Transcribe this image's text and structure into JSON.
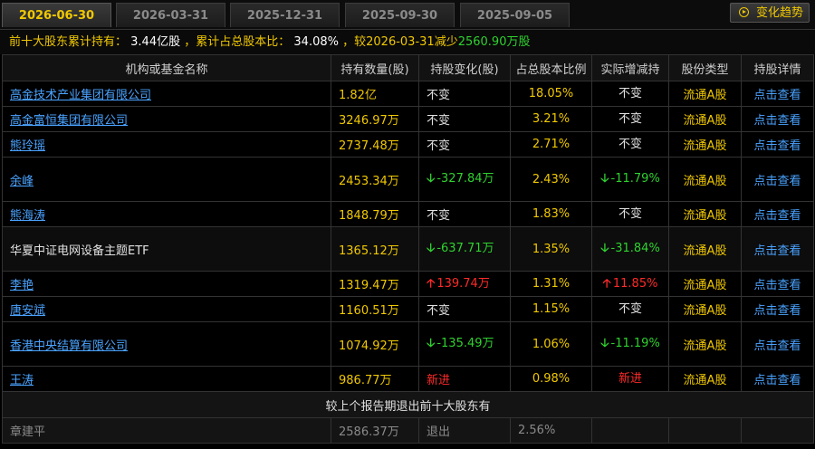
{
  "tabs": [
    {
      "label": "2026-06-30",
      "active": true
    },
    {
      "label": "2026-03-31",
      "active": false
    },
    {
      "label": "2025-12-31",
      "active": false
    },
    {
      "label": "2025-09-30",
      "active": false
    },
    {
      "label": "2025-09-05",
      "active": false
    }
  ],
  "trend_button": {
    "label": "变化趋势"
  },
  "summary": {
    "prefix": "前十大股东累计持有：",
    "total": "3.44亿股",
    "ratio_label": "，累计占总股本比：",
    "ratio": "34.08%",
    "compare_label": "，较",
    "compare_date": "2026-03-31",
    "change_label": "减少",
    "change_value": "2560.90万股"
  },
  "columns": [
    "机构或基金名称",
    "持有数量(股)",
    "持股变化(股)",
    "占总股本比例",
    "实际增减持",
    "股份类型",
    "持股详情"
  ],
  "rows": [
    {
      "name": "高金技术产业集团有限公司",
      "link": true,
      "hold": "1.82亿",
      "change": "不变",
      "change_dir": "none",
      "ratio": "18.05%",
      "actual": "不变",
      "actual_dir": "none",
      "type": "流通A股",
      "detail": "点击查看",
      "tall": false
    },
    {
      "name": "高金富恒集团有限公司",
      "link": true,
      "hold": "3246.97万",
      "change": "不变",
      "change_dir": "none",
      "ratio": "3.21%",
      "actual": "不变",
      "actual_dir": "none",
      "type": "流通A股",
      "detail": "点击查看",
      "tall": false
    },
    {
      "name": "熊玲瑶",
      "link": true,
      "hold": "2737.48万",
      "change": "不变",
      "change_dir": "none",
      "ratio": "2.71%",
      "actual": "不变",
      "actual_dir": "none",
      "type": "流通A股",
      "detail": "点击查看",
      "tall": false
    },
    {
      "name": "余峰",
      "link": true,
      "hold": "2453.34万",
      "change": "-327.84万",
      "change_dir": "down",
      "ratio": "2.43%",
      "actual": "-11.79%",
      "actual_dir": "down",
      "type": "流通A股",
      "detail": "点击查看",
      "tall": true
    },
    {
      "name": "熊海涛",
      "link": true,
      "hold": "1848.79万",
      "change": "不变",
      "change_dir": "none",
      "ratio": "1.83%",
      "actual": "不变",
      "actual_dir": "none",
      "type": "流通A股",
      "detail": "点击查看",
      "tall": false
    },
    {
      "name": "华夏中证电网设备主题ETF",
      "link": false,
      "hold": "1365.12万",
      "change": "-637.71万",
      "change_dir": "down",
      "ratio": "1.35%",
      "actual": "-31.84%",
      "actual_dir": "down",
      "type": "流通A股",
      "detail": "点击查看",
      "tall": true
    },
    {
      "name": "李艳",
      "link": true,
      "hold": "1319.47万",
      "change": "139.74万",
      "change_dir": "up",
      "ratio": "1.31%",
      "actual": "11.85%",
      "actual_dir": "up",
      "type": "流通A股",
      "detail": "点击查看",
      "tall": false
    },
    {
      "name": "唐安斌",
      "link": true,
      "hold": "1160.51万",
      "change": "不变",
      "change_dir": "none",
      "ratio": "1.15%",
      "actual": "不变",
      "actual_dir": "none",
      "type": "流通A股",
      "detail": "点击查看",
      "tall": false
    },
    {
      "name": "香港中央结算有限公司",
      "link": true,
      "hold": "1074.92万",
      "change": "-135.49万",
      "change_dir": "down",
      "ratio": "1.06%",
      "actual": "-11.19%",
      "actual_dir": "down",
      "type": "流通A股",
      "detail": "点击查看",
      "tall": true
    },
    {
      "name": "王涛",
      "link": true,
      "hold": "986.77万",
      "change": "新进",
      "change_dir": "new",
      "ratio": "0.98%",
      "actual": "新进",
      "actual_dir": "new",
      "type": "流通A股",
      "detail": "点击查看",
      "tall": false
    }
  ],
  "exited_header": "较上个报告期退出前十大股东有",
  "exited": [
    {
      "name": "章建平",
      "hold": "2586.37万",
      "change": "退出",
      "ratio": "2.56%"
    }
  ],
  "colors": {
    "accent": "#f0c800",
    "link": "#4aa3ff",
    "down": "#2fd12f",
    "up": "#ff2a2a"
  }
}
